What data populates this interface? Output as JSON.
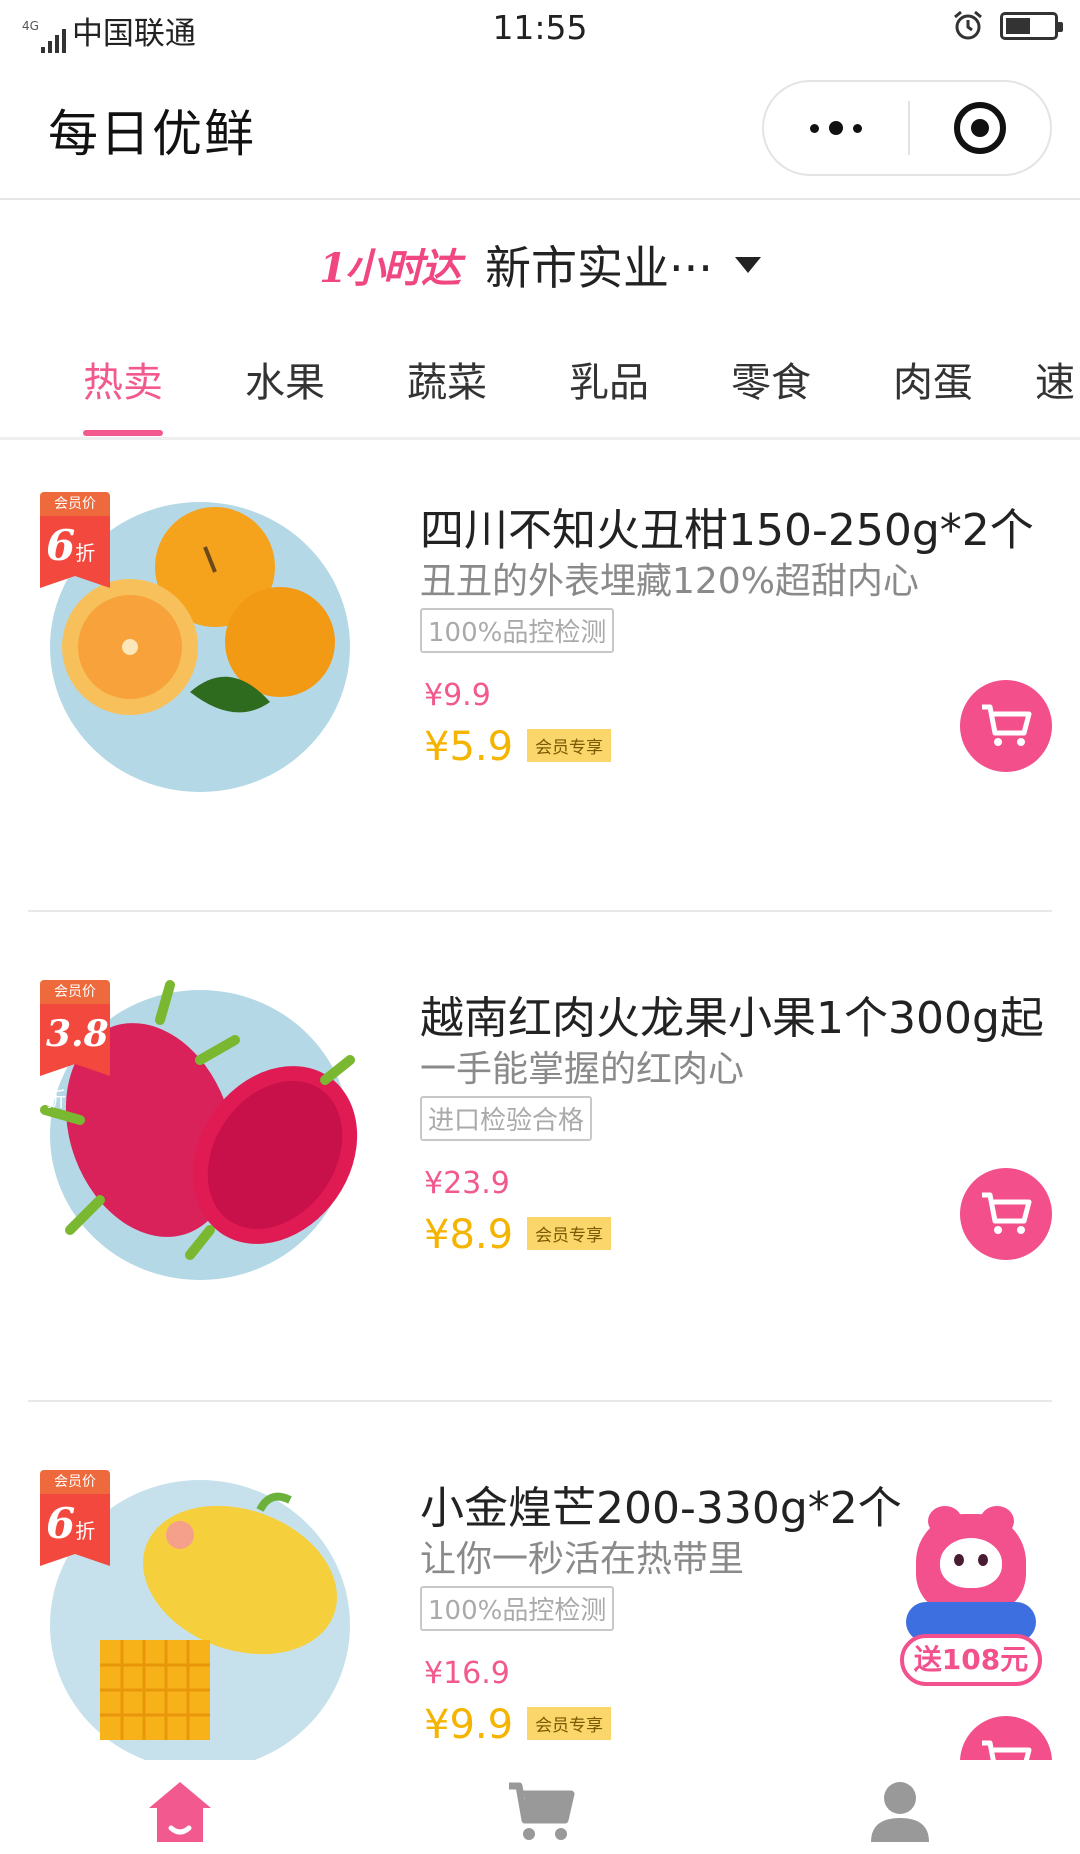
{
  "status_bar": {
    "network": "4G",
    "carrier": "中国联通",
    "time": "11:55"
  },
  "nav": {
    "title": "每日优鲜"
  },
  "delivery": {
    "badge": "1小时达",
    "address": "新市实业···"
  },
  "tabs": [
    {
      "label": "热卖",
      "active": true
    },
    {
      "label": "水果",
      "active": false
    },
    {
      "label": "蔬菜",
      "active": false
    },
    {
      "label": "乳品",
      "active": false
    },
    {
      "label": "零食",
      "active": false
    },
    {
      "label": "肉蛋",
      "active": false
    },
    {
      "label": "速",
      "active": false
    }
  ],
  "products": [
    {
      "badge_top": "会员价",
      "badge_discount": "6",
      "badge_unit": "折",
      "title": "四川不知火丑柑150-250g*2个",
      "subtitle": "丑丑的外表埋藏120%超甜内心",
      "tag": "100%品控检测",
      "price": "¥9.9",
      "member_price": "¥5.9",
      "member_label": "会员专享",
      "image": "ugly-orange-image"
    },
    {
      "badge_top": "会员价",
      "badge_discount": "3.8",
      "badge_unit": "折",
      "title": "越南红肉火龙果小果1个300g起",
      "subtitle": "一手能掌握的红肉心",
      "tag": "进口检验合格",
      "price": "¥23.9",
      "member_price": "¥8.9",
      "member_label": "会员专享",
      "image": "dragon-fruit-image"
    },
    {
      "badge_top": "会员价",
      "badge_discount": "6",
      "badge_unit": "折",
      "title": "小金煌芒200-330g*2个",
      "subtitle": "让你一秒活在热带里",
      "tag": "100%品控检测",
      "price": "¥16.9",
      "member_price": "¥9.9",
      "member_label": "会员专享",
      "image": "mango-image"
    }
  ],
  "mascot": {
    "label": "送108元"
  },
  "tabbar": {
    "items": [
      {
        "icon": "home-icon",
        "active": true
      },
      {
        "icon": "cart-icon",
        "active": false
      },
      {
        "icon": "user-icon",
        "active": false
      }
    ]
  },
  "colors": {
    "accent": "#f25a8f",
    "member_price": "#f4b400",
    "badge_red": "#f2483e"
  }
}
